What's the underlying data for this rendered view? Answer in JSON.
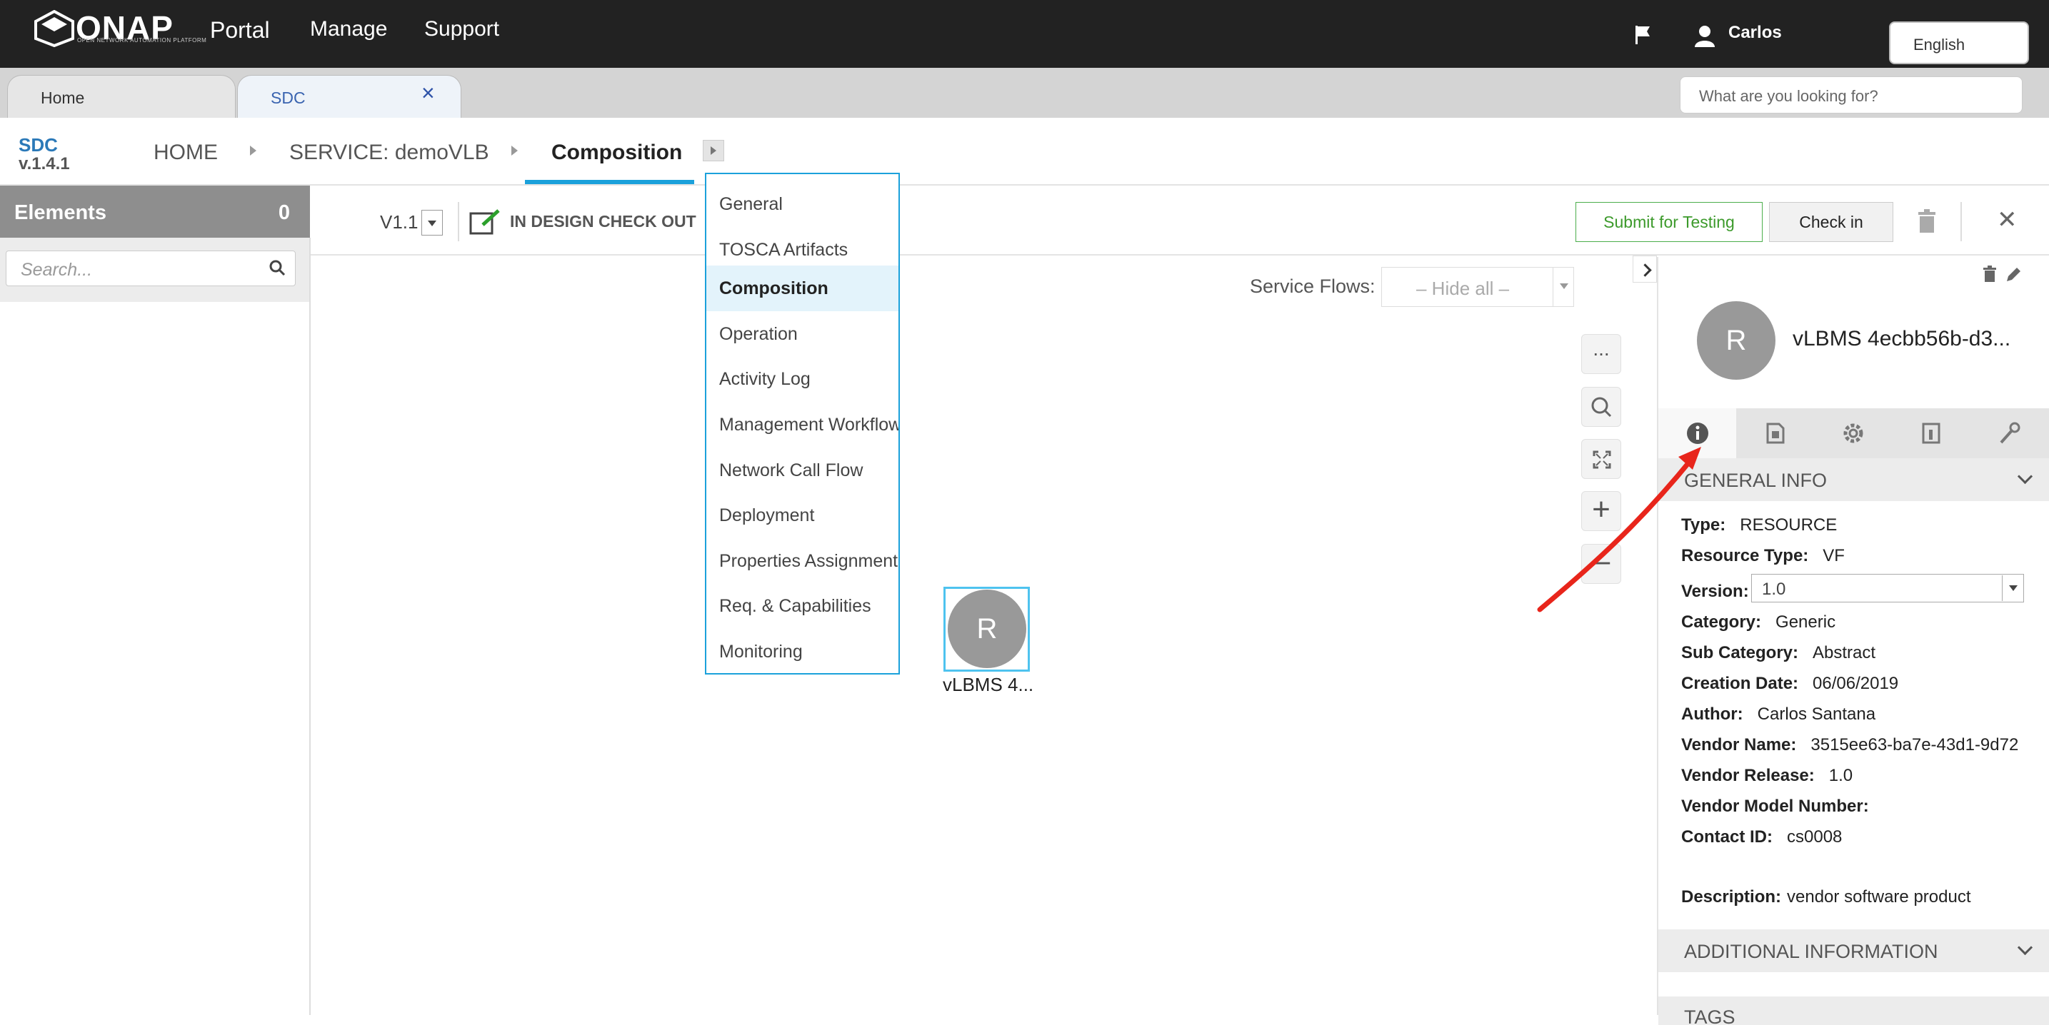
{
  "topbar": {
    "logo_text": "ONAP",
    "logo_tagline": "OPEN NETWORK AUTOMATION PLATFORM",
    "nav": [
      "Portal",
      "Manage",
      "Support"
    ],
    "username": "Carlos",
    "language": "English",
    "icons": [
      "flag-icon",
      "user-icon"
    ]
  },
  "tabs": {
    "home": "Home",
    "sdc": "SDC",
    "close_icon": "×",
    "search_placeholder": "What are you looking for?"
  },
  "breadcrumb": {
    "app_name": "SDC",
    "app_version": "v.1.4.1",
    "items": [
      "HOME",
      "SERVICE: demoVLB",
      "Composition"
    ]
  },
  "composition_menu": {
    "items": [
      "General",
      "TOSCA Artifacts",
      "Composition",
      "Operation",
      "Activity Log",
      "Management Workflow",
      "Network Call Flow",
      "Deployment",
      "Properties Assignment",
      "Req. & Capabilities",
      "Monitoring"
    ],
    "active": "Composition"
  },
  "left_panel": {
    "title": "Elements",
    "count": "0",
    "search_placeholder": "Search..."
  },
  "toolbar": {
    "version": "V1.1",
    "status": "IN DESIGN CHECK OUT",
    "submit_label": "Submit for Testing",
    "checkin_label": "Check in",
    "close_icon": "✕"
  },
  "canvas": {
    "service_flows_label": "Service Flows:",
    "service_flows_value": "– Hide all –",
    "tools": [
      "...",
      "search-icon",
      "fit-screen-icon",
      "+",
      "–"
    ],
    "node": {
      "letter": "R",
      "label": "vLBMS 4..."
    }
  },
  "right_panel": {
    "avatar_letter": "R",
    "title": "vLBMS 4ecbb56b-d3...",
    "tab_icons": [
      "info-icon",
      "deployment-artifact-icon",
      "settings-icon",
      "api-artifact-icon",
      "wrench-icon"
    ],
    "general_info_title": "GENERAL INFO",
    "fields": {
      "type": {
        "label": "Type:",
        "value": "RESOURCE"
      },
      "resource_type": {
        "label": "Resource Type:",
        "value": "VF"
      },
      "version": {
        "label": "Version:",
        "value": "1.0"
      },
      "category": {
        "label": "Category:",
        "value": "Generic"
      },
      "sub_category": {
        "label": "Sub Category:",
        "value": "Abstract"
      },
      "creation_date": {
        "label": "Creation Date:",
        "value": "06/06/2019"
      },
      "author": {
        "label": "Author:",
        "value": "Carlos Santana"
      },
      "vendor_name": {
        "label": "Vendor Name:",
        "value": "3515ee63-ba7e-43d1-9d72"
      },
      "vendor_release": {
        "label": "Vendor Release:",
        "value": "1.0"
      },
      "vendor_model_number": {
        "label": "Vendor Model Number:",
        "value": ""
      },
      "contact_id": {
        "label": "Contact ID:",
        "value": "cs0008"
      },
      "description": {
        "label": "Description:",
        "value": "vendor software product"
      }
    },
    "additional_info_title": "ADDITIONAL INFORMATION",
    "tags_title": "TAGS"
  },
  "colors": {
    "accent": "#1ba1db",
    "submit_green": "#3c9a2b",
    "annotation_red": "#e8251b"
  }
}
